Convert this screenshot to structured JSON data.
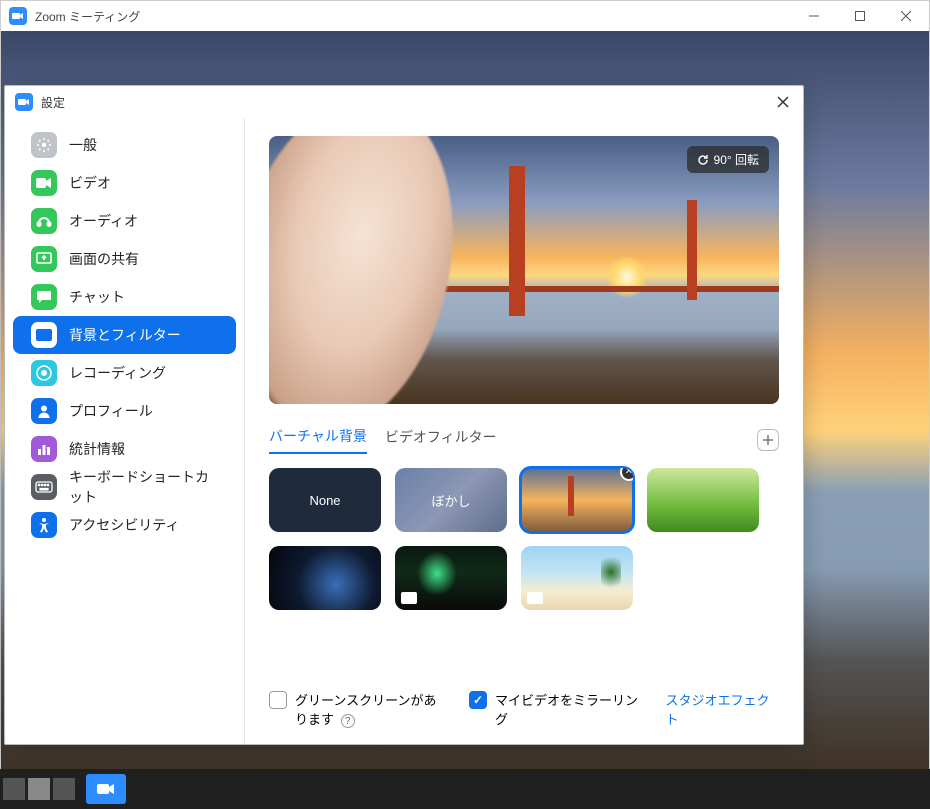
{
  "mainWindow": {
    "title": "Zoom ミーティング"
  },
  "settings": {
    "title": "設定",
    "sidebar": [
      {
        "label": "一般",
        "icon": "gear",
        "color": "#c0c4c8"
      },
      {
        "label": "ビデオ",
        "icon": "video",
        "color": "#34c759"
      },
      {
        "label": "オーディオ",
        "icon": "audio",
        "color": "#34c759"
      },
      {
        "label": "画面の共有",
        "icon": "screen",
        "color": "#34c759"
      },
      {
        "label": "チャット",
        "icon": "chat",
        "color": "#34c759"
      },
      {
        "label": "背景とフィルター",
        "icon": "background",
        "color": "#0E71EB",
        "active": true
      },
      {
        "label": "レコーディング",
        "icon": "record",
        "color": "#2bc8e0"
      },
      {
        "label": "プロフィール",
        "icon": "profile",
        "color": "#0E71EB"
      },
      {
        "label": "統計情報",
        "icon": "stats",
        "color": "#a259d9"
      },
      {
        "label": "キーボードショートカット",
        "icon": "keyboard",
        "color": "#5a5d63"
      },
      {
        "label": "アクセシビリティ",
        "icon": "accessibility",
        "color": "#0E71EB"
      }
    ],
    "preview": {
      "rotateLabel": "90° 回転"
    },
    "tabs": [
      {
        "label": "バーチャル背景",
        "active": true
      },
      {
        "label": "ビデオフィルター",
        "active": false
      }
    ],
    "thumbnails": [
      {
        "key": "none",
        "label": "None"
      },
      {
        "key": "blur",
        "label": "ぼかし"
      },
      {
        "key": "bridge",
        "label": "",
        "selected": true,
        "removable": true
      },
      {
        "key": "grass",
        "label": ""
      },
      {
        "key": "earth",
        "label": ""
      },
      {
        "key": "aurora",
        "label": "",
        "hasBadge": true
      },
      {
        "key": "beach",
        "label": "",
        "hasBadge": true
      }
    ],
    "footer": {
      "greenScreen": {
        "label": "グリーンスクリーンがあります",
        "checked": false,
        "hasHelp": true
      },
      "mirror": {
        "label": "マイビデオをミラーリング",
        "checked": true
      },
      "studioLink": "スタジオエフェクト"
    }
  }
}
